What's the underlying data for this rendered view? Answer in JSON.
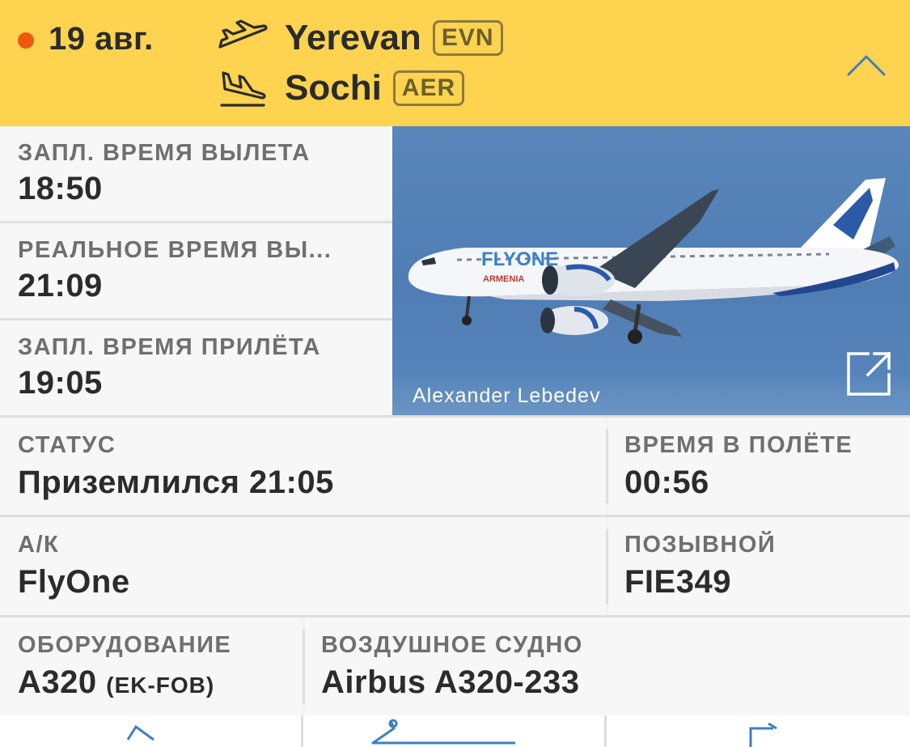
{
  "header": {
    "date": "19 авг.",
    "status_dot_color": "#ec5a0e",
    "departure": {
      "city": "Yerevan",
      "code": "EVN",
      "icon": "takeoff-icon"
    },
    "arrival": {
      "city": "Sochi",
      "code": "AER",
      "icon": "landing-icon"
    },
    "collapse_icon": "chevron-up-icon",
    "background_color": "#fdd34f"
  },
  "times": {
    "sched_departure": {
      "label": "ЗАПЛ. ВРЕМЯ ВЫЛЕТА",
      "value": "18:50"
    },
    "actual_departure": {
      "label": "РЕАЛЬНОЕ ВРЕМЯ ВЫ...",
      "value": "21:09"
    },
    "sched_arrival": {
      "label": "ЗАПЛ. ВРЕМЯ ПРИЛЁТА",
      "value": "19:05"
    }
  },
  "photo": {
    "credit": "Alexander Lebedev",
    "expand_icon": "external-link-icon"
  },
  "status": {
    "label": "СТАТУС",
    "value": "Приземлился 21:05"
  },
  "flight_time": {
    "label": "ВРЕМЯ В ПОЛЁТЕ",
    "value": "00:56"
  },
  "airline": {
    "label": "А/К",
    "value": "FlyOne"
  },
  "callsign": {
    "label": "ПОЗЫВНОЙ",
    "value": "FIE349"
  },
  "equipment": {
    "label": "ОБОРУДОВАНИЕ",
    "value": "A320",
    "registration": "(EK-FOB)"
  },
  "aircraft": {
    "label": "ВОЗДУШНОЕ СУДНО",
    "value": "Airbus A320-233"
  },
  "toolbar": {
    "icons": [
      "route-icon",
      "aircraft-icon",
      "share-icon"
    ]
  }
}
